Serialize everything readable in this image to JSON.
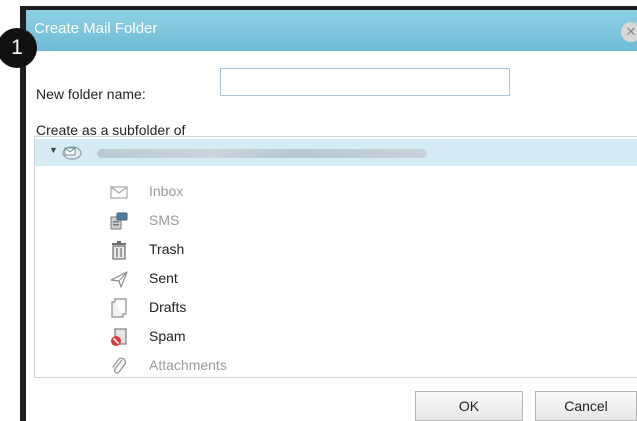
{
  "dialog": {
    "title": "Create Mail Folder",
    "close_icon": "close-icon",
    "step_badge": "1"
  },
  "form": {
    "name_label": "New folder name:",
    "name_value": "",
    "subfolder_label": "Create as a subfolder of"
  },
  "tree": {
    "account": {
      "label": "",
      "icon": "mail-account-icon",
      "expanded": true
    },
    "folders": [
      {
        "label": "Inbox",
        "icon": "envelope-icon",
        "enabled": false
      },
      {
        "label": "SMS",
        "icon": "sms-icon",
        "enabled": false
      },
      {
        "label": "Trash",
        "icon": "trash-icon",
        "enabled": true
      },
      {
        "label": "Sent",
        "icon": "sent-icon",
        "enabled": true
      },
      {
        "label": "Drafts",
        "icon": "drafts-icon",
        "enabled": true
      },
      {
        "label": "Spam",
        "icon": "spam-icon",
        "enabled": true
      },
      {
        "label": "Attachments",
        "icon": "paperclip-icon",
        "enabled": false
      }
    ]
  },
  "buttons": {
    "ok": "OK",
    "cancel": "Cancel"
  },
  "colors": {
    "titlebar": "#7cc4dc",
    "selected_row": "#d5ecf5",
    "disabled_text": "#9a9a9a"
  }
}
